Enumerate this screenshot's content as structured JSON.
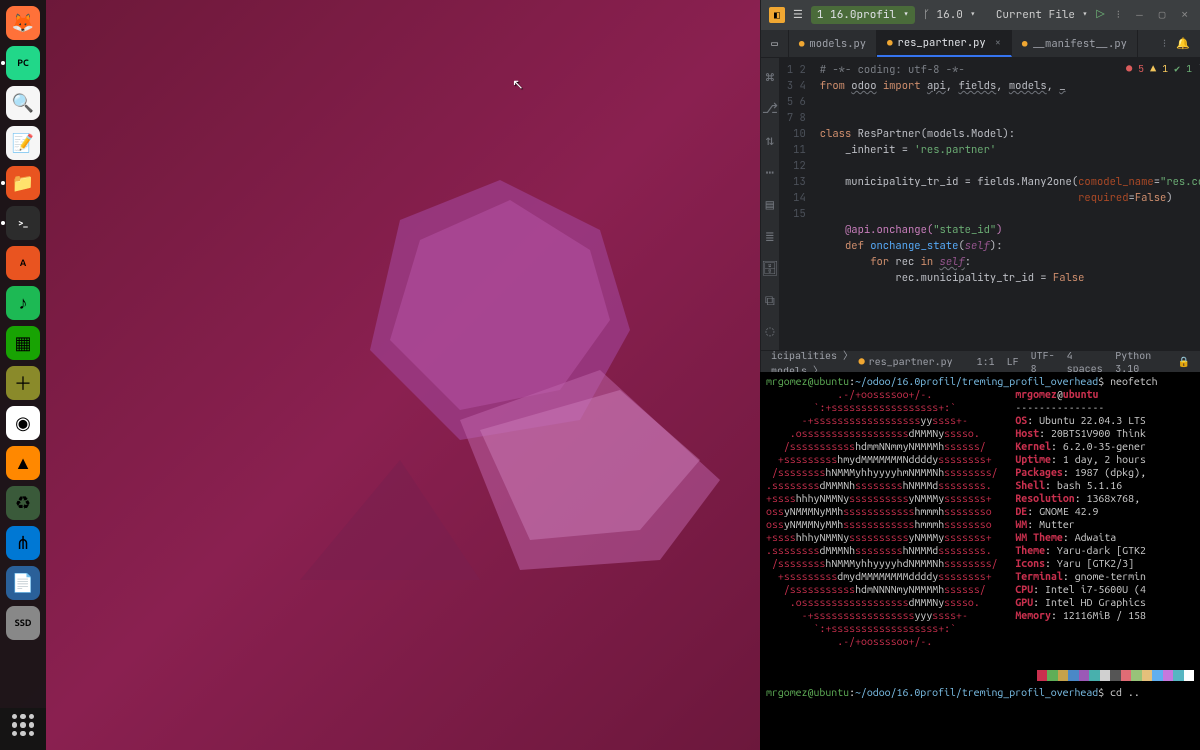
{
  "dock": {
    "items": [
      {
        "name": "firefox",
        "bg": "#ff7139",
        "glyph": "🦊"
      },
      {
        "name": "pycharm",
        "bg": "#21d789",
        "glyph": "PC",
        "active": true,
        "text": true
      },
      {
        "name": "magnifier",
        "bg": "#f6f6f6",
        "glyph": "🔍"
      },
      {
        "name": "text-editor",
        "bg": "#f6f6f6",
        "glyph": "📝"
      },
      {
        "name": "files",
        "bg": "#e95420",
        "glyph": "📁",
        "active": true
      },
      {
        "name": "terminal",
        "bg": "#2c2c2c",
        "glyph": ">_",
        "active": true,
        "text": true
      },
      {
        "name": "software",
        "bg": "#e95420",
        "glyph": "A",
        "text": true
      },
      {
        "name": "spotify",
        "bg": "#1db954",
        "glyph": "♪"
      },
      {
        "name": "calc",
        "bg": "#18a303",
        "glyph": "▦"
      },
      {
        "name": "add",
        "bg": "#8a8a2a",
        "glyph": "＋"
      },
      {
        "name": "chrome",
        "bg": "#ffffff",
        "glyph": "◉"
      },
      {
        "name": "vlc",
        "bg": "#ff8800",
        "glyph": "▲"
      },
      {
        "name": "trash",
        "bg": "#3a5a3a",
        "glyph": "♻"
      },
      {
        "name": "vscode",
        "bg": "#0078d4",
        "glyph": "⋔"
      },
      {
        "name": "writer",
        "bg": "#2a6099",
        "glyph": "📄"
      },
      {
        "name": "ssd",
        "bg": "#888",
        "glyph": "SSD",
        "text": true
      }
    ]
  },
  "pycharm": {
    "project_badge": "1",
    "project": "16.0profil",
    "branch": "16.0",
    "run_config": "Current File",
    "tabs": [
      {
        "label": "models.py"
      },
      {
        "label": "res_partner.py",
        "active": true
      },
      {
        "label": "__manifest__.py"
      }
    ],
    "inspection": {
      "errors": "5",
      "warnings": "1",
      "ok": "1"
    },
    "gutter": [
      "1",
      "2",
      "3",
      "4",
      "5",
      "6",
      "7",
      "8",
      "",
      "10",
      "11",
      "12",
      "13",
      "14",
      "15"
    ],
    "code": {
      "l1": "# -*- coding: utf-8 -*-",
      "l2a": "from",
      "l2b": "odoo",
      "l2c": "import",
      "l2d": "api",
      "l2e": "fields",
      "l2f": "models",
      "l2g": "_",
      "l5a": "class",
      "l5b": "ResPartner",
      "l5c": "(models.Model):",
      "l6a": "_inherit",
      "l6b": " = ",
      "l6c": "'res.partner'",
      "l8a": "municipality_tr_id = fields.Many2one(",
      "l8b": "comodel_name",
      "l8c": "=",
      "l8d": "\"res.co",
      "l9a": "required",
      "l9b": "=",
      "l9c": "False",
      "l11a": "@api.onchange(",
      "l11b": "\"state_id\"",
      "l11c": ")",
      "l12a": "def",
      "l12b": "onchange_state",
      "l12c": "(",
      "l12d": "self",
      "l12e": "):",
      "l13a": "for",
      "l13b": "rec",
      "l13c": "in",
      "l13d": "self",
      "l13e": ":",
      "l14a": "rec.municipality_tr_id = ",
      "l14b": "False"
    },
    "breadcrumb": [
      "icipalities",
      "models",
      "res_partner.py"
    ],
    "status": {
      "pos": "1:1",
      "eol": "LF",
      "enc": "UTF-8",
      "indent": "4 spaces",
      "py": "Python 3.10"
    }
  },
  "terminal": {
    "prompt_user": "mrgomez",
    "prompt_at": "@",
    "prompt_host": "ubuntu",
    "prompt_path": "~/odoo/16.0profil/treming_profil_overhead",
    "cmd1": "neofetch",
    "cmd2": "cd ..",
    "ascii": [
      "            .-/+oossssoo+/-.",
      "        `:+ssssssssssssssssss+:`",
      "      -+ssssssssssssssssssyyssss+-",
      "    .ossssssssssssssssssdMMMNysssso.",
      "   /ssssssssssshdmmNNmmyNMMMMhssssss/",
      "  +ssssssssshmydMMMMMMMNddddyssssssss+",
      " /sssssssshNMMMyhhyyyyhmNMMMNhssssssss/",
      ".ssssssssdMMMNhsssssssshNMMMdssssssss.",
      "+sssshhhyNMMNyssssssssssyNMMMysssssss+",
      "ossyNMMMNyMMhsssssssssssshmmmhssssssso",
      "ossyNMMMNyMMhsssssssssssshmmmhssssssso",
      "+sssshhhyNMMNyssssssssssyNMMMysssssss+",
      ".ssssssssdMMMNhsssssssshNMMMdssssssss.",
      " /sssssssshNMMMyhhyyyyhdNMMMNhssssssss/",
      "  +sssssssssdmydMMMMMMMMddddyssssssss+",
      "   /ssssssssssshdmNNNNmyNMMMMhssssss/",
      "    .ossssssssssssssssssdMMMNysssso.",
      "      -+sssssssssssssssssyyyssss+-",
      "        `:+ssssssssssssssssss+:`",
      "            .-/+oossssoo+/-."
    ],
    "info": [
      [
        "",
        "mrgomez@ubuntu"
      ],
      [
        "",
        "---------------"
      ],
      [
        "OS",
        "Ubuntu 22.04.3 LTS"
      ],
      [
        "Host",
        "20BTS1V900 Think"
      ],
      [
        "Kernel",
        "6.2.0-35-gener"
      ],
      [
        "Uptime",
        "1 day, 2 hours"
      ],
      [
        "Packages",
        "1987 (dpkg),"
      ],
      [
        "Shell",
        "bash 5.1.16"
      ],
      [
        "Resolution",
        "1368x768,"
      ],
      [
        "DE",
        "GNOME 42.9"
      ],
      [
        "WM",
        "Mutter"
      ],
      [
        "WM Theme",
        "Adwaita"
      ],
      [
        "Theme",
        "Yaru-dark [GTK2"
      ],
      [
        "Icons",
        "Yaru [GTK2/3]"
      ],
      [
        "Terminal",
        "gnome-termin"
      ],
      [
        "CPU",
        "Intel i7-5600U (4"
      ],
      [
        "GPU",
        "Intel HD Graphics"
      ],
      [
        "Memory",
        "12116MiB / 158"
      ]
    ],
    "palette": [
      "#000",
      "#c9304e",
      "#5fae57",
      "#c6a24a",
      "#4a88c7",
      "#9b59b6",
      "#48b0ad",
      "#d0d0d0",
      "#555",
      "#e06c75",
      "#98c379",
      "#e5c07b",
      "#61afef",
      "#c678dd",
      "#56b6c2",
      "#fff"
    ]
  }
}
